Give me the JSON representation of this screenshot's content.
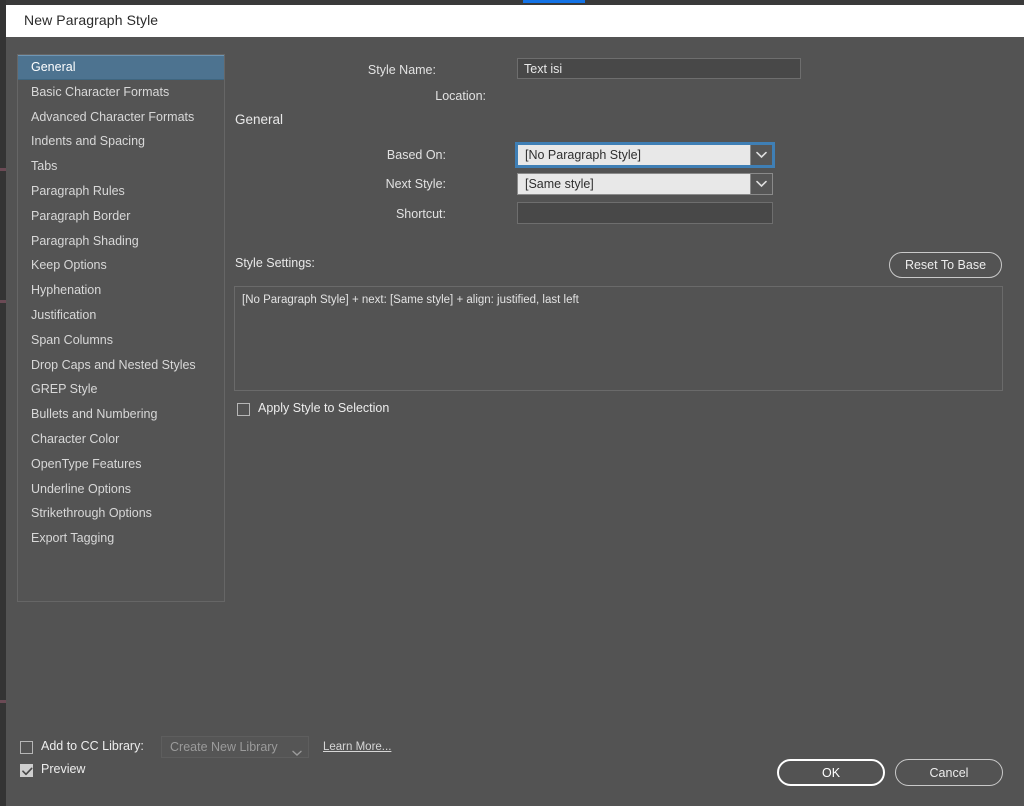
{
  "window": {
    "title": "New Paragraph Style"
  },
  "sidebar": {
    "items": [
      {
        "label": "General",
        "selected": true
      },
      {
        "label": "Basic Character Formats",
        "selected": false
      },
      {
        "label": "Advanced Character Formats",
        "selected": false
      },
      {
        "label": "Indents and Spacing",
        "selected": false
      },
      {
        "label": "Tabs",
        "selected": false
      },
      {
        "label": "Paragraph Rules",
        "selected": false
      },
      {
        "label": "Paragraph Border",
        "selected": false
      },
      {
        "label": "Paragraph Shading",
        "selected": false
      },
      {
        "label": "Keep Options",
        "selected": false
      },
      {
        "label": "Hyphenation",
        "selected": false
      },
      {
        "label": "Justification",
        "selected": false
      },
      {
        "label": "Span Columns",
        "selected": false
      },
      {
        "label": "Drop Caps and Nested Styles",
        "selected": false
      },
      {
        "label": "GREP Style",
        "selected": false
      },
      {
        "label": "Bullets and Numbering",
        "selected": false
      },
      {
        "label": "Character Color",
        "selected": false
      },
      {
        "label": "OpenType Features",
        "selected": false
      },
      {
        "label": "Underline Options",
        "selected": false
      },
      {
        "label": "Strikethrough Options",
        "selected": false
      },
      {
        "label": "Export Tagging",
        "selected": false
      }
    ]
  },
  "main": {
    "style_name_label": "Style Name:",
    "style_name_value": "Text isi",
    "location_label": "Location:",
    "location_value": "",
    "section_heading": "General",
    "based_on_label": "Based On:",
    "based_on_value": "[No Paragraph Style]",
    "next_style_label": "Next Style:",
    "next_style_value": "[Same style]",
    "shortcut_label": "Shortcut:",
    "shortcut_value": "",
    "style_settings_label": "Style Settings:",
    "reset_to_base_label": "Reset To Base",
    "style_settings_text": "[No Paragraph Style] + next: [Same style] + align: justified, last left",
    "apply_style_label": "Apply Style to Selection",
    "apply_style_checked": false
  },
  "footer": {
    "add_to_cc_library_label": "Add to CC Library:",
    "add_to_cc_library_checked": false,
    "cc_library_value": "Create New Library",
    "learn_more_label": "Learn More...",
    "preview_label": "Preview",
    "preview_checked": true,
    "ok_label": "OK",
    "cancel_label": "Cancel"
  },
  "colors": {
    "dialog_background": "#535353",
    "titlebar_background": "#ffffff",
    "selection_blue": "#4d7390",
    "focus_blue": "#3f7fb5",
    "combo_background": "#e8e8e8",
    "accent_tab_blue": "#1473e6"
  }
}
